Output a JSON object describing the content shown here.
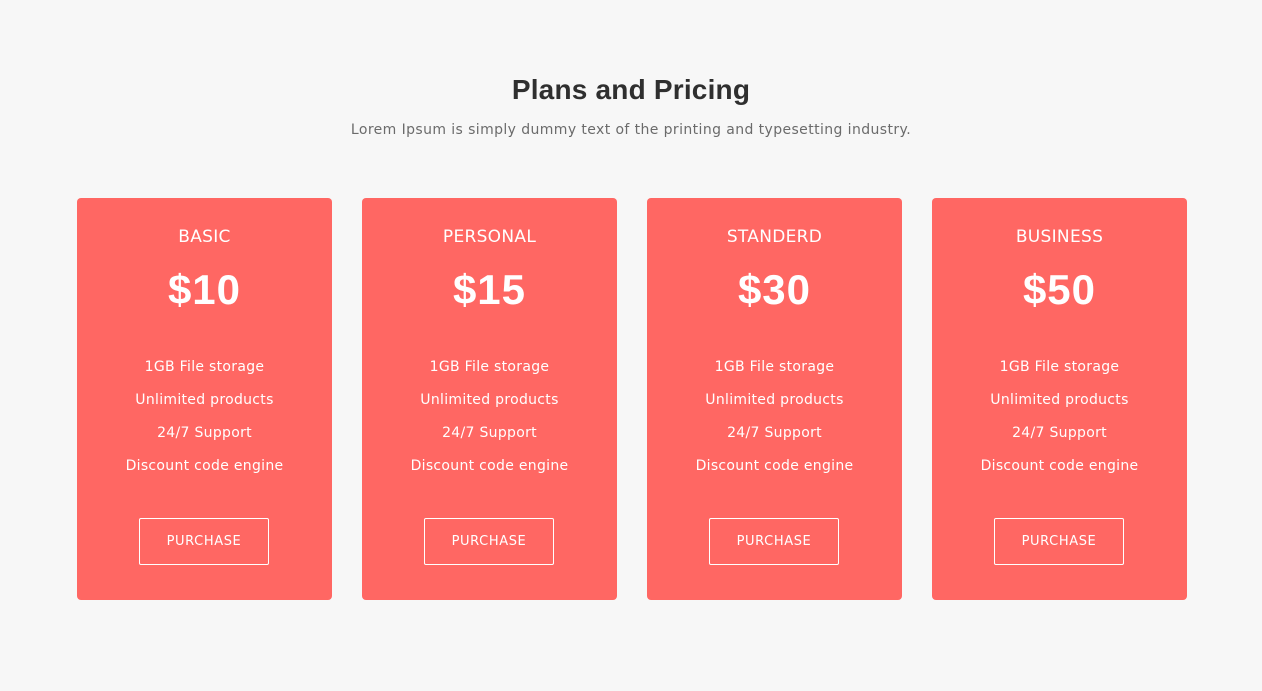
{
  "header": {
    "title": "Plans and Pricing",
    "subtitle": "Lorem Ipsum is simply dummy text of the printing and typesetting industry."
  },
  "colors": {
    "background": "#f7f7f7",
    "card": "#ff6763",
    "text_on_card": "#ffffff",
    "title": "#2f2f2f",
    "subtitle": "#6b6b6b"
  },
  "plans": [
    {
      "name": "BASIC",
      "price": "$10",
      "features": [
        "1GB File storage",
        "Unlimited products",
        "24/7 Support",
        "Discount code engine"
      ],
      "button_label": "PURCHASE"
    },
    {
      "name": "PERSONAL",
      "price": "$15",
      "features": [
        "1GB File storage",
        "Unlimited products",
        "24/7 Support",
        "Discount code engine"
      ],
      "button_label": "PURCHASE"
    },
    {
      "name": "STANDERD",
      "price": "$30",
      "features": [
        "1GB File storage",
        "Unlimited products",
        "24/7 Support",
        "Discount code engine"
      ],
      "button_label": "PURCHASE"
    },
    {
      "name": "BUSINESS",
      "price": "$50",
      "features": [
        "1GB File storage",
        "Unlimited products",
        "24/7 Support",
        "Discount code engine"
      ],
      "button_label": "PURCHASE"
    }
  ]
}
